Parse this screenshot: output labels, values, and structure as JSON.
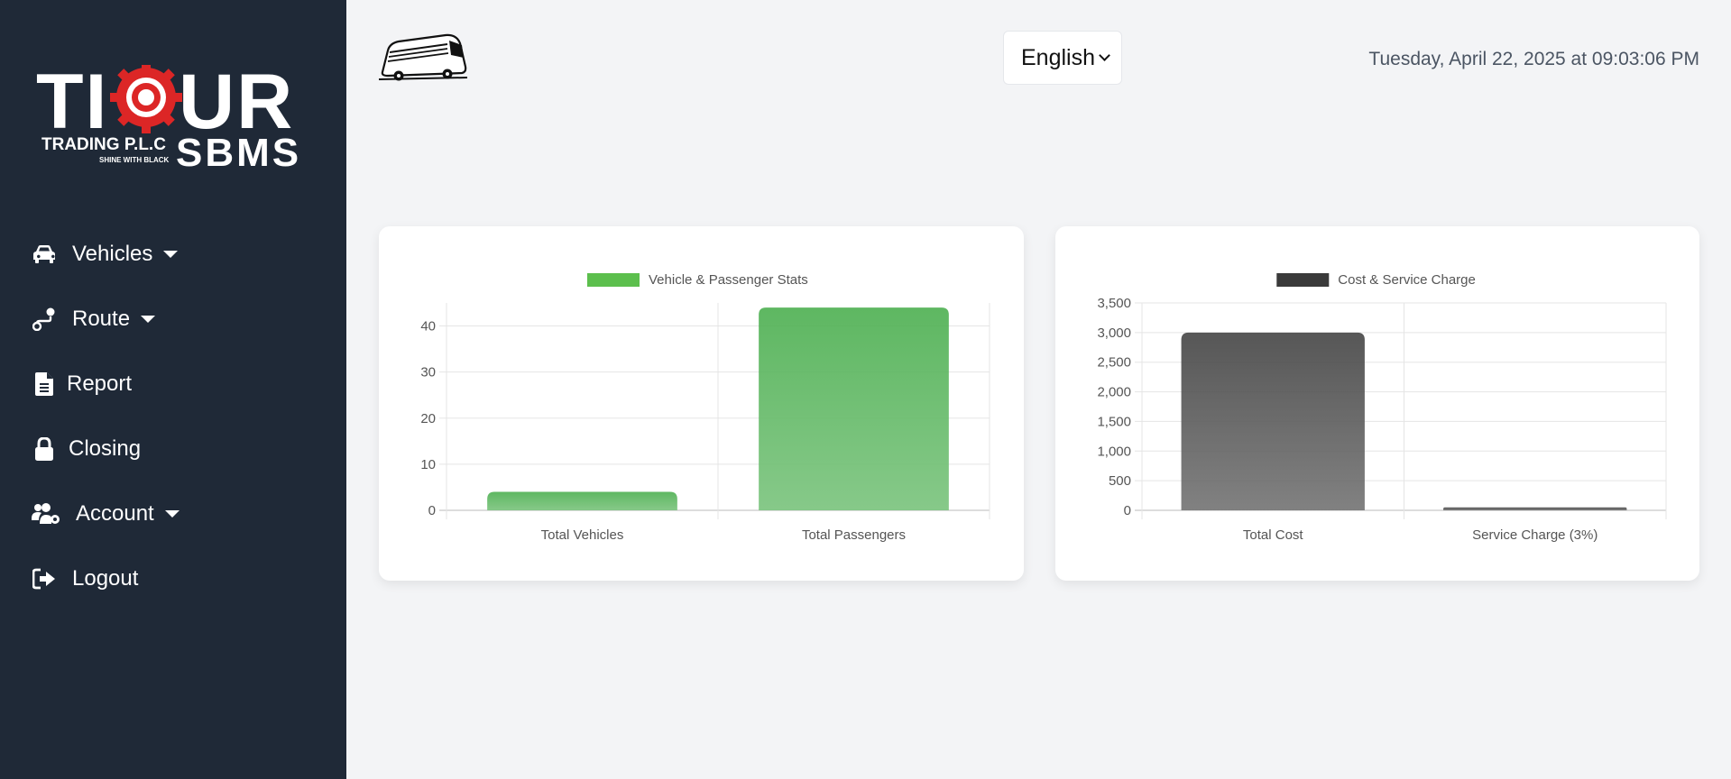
{
  "brand": {
    "wordmark": "TIOUR",
    "sub": "TRADING P.L.C",
    "tagline": "SHINE WITH BLACK",
    "product": "SBMS",
    "accent": "#dc2626"
  },
  "sidebar": {
    "items": [
      {
        "label": "Vehicles",
        "icon": "car-icon",
        "dropdown": true
      },
      {
        "label": "Route",
        "icon": "route-icon",
        "dropdown": true
      },
      {
        "label": "Report",
        "icon": "document-icon",
        "dropdown": false
      },
      {
        "label": "Closing",
        "icon": "lock-icon",
        "dropdown": false
      },
      {
        "label": "Account",
        "icon": "users-gear-icon",
        "dropdown": true
      },
      {
        "label": "Logout",
        "icon": "logout-icon",
        "dropdown": false
      }
    ]
  },
  "header": {
    "language": "English",
    "datetime": "Tuesday, April 22, 2025 at 09:03:06 PM"
  },
  "chart_data": [
    {
      "type": "bar",
      "title": "",
      "legend": [
        "Vehicle & Passenger Stats"
      ],
      "categories": [
        "Total Vehicles",
        "Total Passengers"
      ],
      "series": [
        {
          "name": "Vehicle & Passenger Stats",
          "values": [
            4,
            44
          ]
        }
      ],
      "ylim": [
        0,
        45
      ],
      "yticks": [
        "0",
        "10",
        "20",
        "30",
        "40"
      ],
      "ytick_values": [
        0,
        10,
        20,
        30,
        40
      ],
      "color": "#4caf50",
      "legend_color": "#5cbf4d",
      "grid": true,
      "legend_position": "top"
    },
    {
      "type": "bar",
      "title": "",
      "legend": [
        "Cost & Service Charge"
      ],
      "categories": [
        "Total Cost",
        "Service Charge (3%)"
      ],
      "series": [
        {
          "name": "Cost & Service Charge",
          "values": [
            3000,
            50
          ]
        }
      ],
      "ylim": [
        0,
        3500
      ],
      "yticks": [
        "0",
        "500",
        "1,000",
        "1,500",
        "2,000",
        "2,500",
        "3,000",
        "3,500"
      ],
      "ytick_values": [
        0,
        500,
        1000,
        1500,
        2000,
        2500,
        3000,
        3500
      ],
      "color": "#444444",
      "legend_color": "#3a3a3a",
      "grid": true,
      "legend_position": "top"
    }
  ]
}
